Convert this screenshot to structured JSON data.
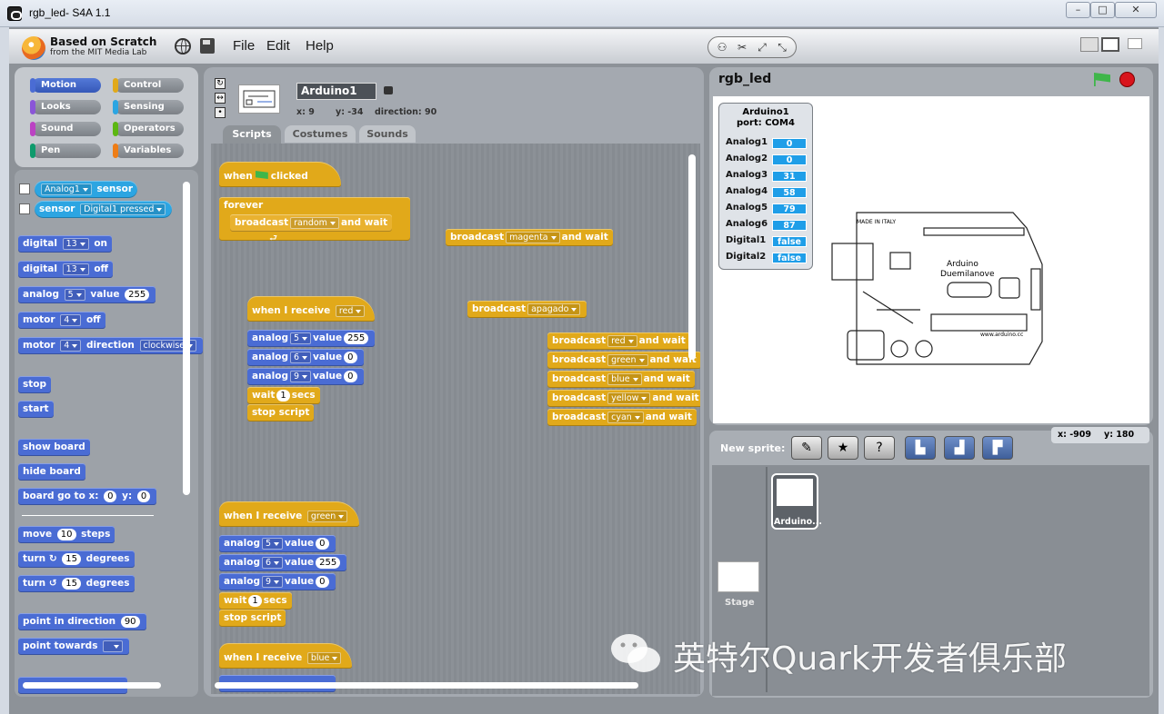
{
  "window": {
    "title": "rgb_led- S4A 1.1",
    "min": "–",
    "max": "□",
    "close": "✕"
  },
  "logo": {
    "line1": "Based on Scratch",
    "line2": "from the MIT Media Lab"
  },
  "menu": {
    "file": "File",
    "edit": "Edit",
    "help": "Help"
  },
  "categories": [
    {
      "label": "Motion",
      "color": "#4a6cd4"
    },
    {
      "label": "Control",
      "color": "#e1a91a"
    },
    {
      "label": "Looks",
      "color": "#8a55d7"
    },
    {
      "label": "Sensing",
      "color": "#2ca5e2"
    },
    {
      "label": "Sound",
      "color": "#bb42c3"
    },
    {
      "label": "Operators",
      "color": "#5cb712"
    },
    {
      "label": "Pen",
      "color": "#0e9a6c"
    },
    {
      "label": "Variables",
      "color": "#ee7d16"
    }
  ],
  "palette": {
    "s1": {
      "dd": "Analog1",
      "t": "sensor"
    },
    "s2": {
      "t": "sensor",
      "dd": "Digital1 pressed"
    },
    "d1": {
      "t": "digital",
      "n": "13",
      "t2": "on"
    },
    "d2": {
      "t": "digital",
      "n": "13",
      "t2": "off"
    },
    "a1": {
      "t": "analog",
      "n": "5",
      "t2": "value",
      "v": "255"
    },
    "m1": {
      "t": "motor",
      "n": "4",
      "t2": "off"
    },
    "m2": {
      "t": "motor",
      "n": "4",
      "t2": "direction",
      "dd": "clockwise"
    },
    "stop": "stop",
    "start": "start",
    "show": "show board",
    "hide": "hide board",
    "go": {
      "t": "board go to x:",
      "x": "0",
      "t2": "y:",
      "y": "0"
    },
    "move": {
      "t": "move",
      "n": "10",
      "t2": "steps"
    },
    "tr": {
      "t": "turn",
      "n": "15",
      "t2": "degrees"
    },
    "tl": {
      "t": "turn",
      "n": "15",
      "t2": "degrees"
    },
    "pd": {
      "t": "point in direction",
      "v": "90"
    },
    "pt": {
      "t": "point towards"
    }
  },
  "sprite": {
    "name": "Arduino1",
    "x": "x: 9",
    "y": "y: -34",
    "dir": "direction: 90"
  },
  "tabs": {
    "scripts": "Scripts",
    "costumes": "Costumes",
    "sounds": "Sounds"
  },
  "scripts": {
    "flag": {
      "when": "when",
      "clicked": "clicked",
      "forever": "forever",
      "bc": "broadcast",
      "msg": "random",
      "wait": "and wait"
    },
    "magenta": {
      "bc": "broadcast",
      "msg": "magenta",
      "wait": "and wait"
    },
    "apagado": {
      "bc": "broadcast",
      "msg": "apagado"
    },
    "red": {
      "hat": "when I receive",
      "msg": "red",
      "a": [
        [
          "5",
          "255"
        ],
        [
          "6",
          "0"
        ],
        [
          "9",
          "0"
        ]
      ],
      "wait": "wait",
      "secs": "1",
      "secs_t": "secs",
      "stop": "stop script"
    },
    "bcl": [
      {
        "bc": "broadcast",
        "msg": "red",
        "wait": "and wait"
      },
      {
        "bc": "broadcast",
        "msg": "green",
        "wait": "and wait"
      },
      {
        "bc": "broadcast",
        "msg": "blue",
        "wait": "and wait"
      },
      {
        "bc": "broadcast",
        "msg": "yellow",
        "wait": "and wait"
      },
      {
        "bc": "broadcast",
        "msg": "cyan",
        "wait": "and wait"
      }
    ],
    "green": {
      "hat": "when I receive",
      "msg": "green",
      "a": [
        [
          "5",
          "0"
        ],
        [
          "6",
          "255"
        ],
        [
          "9",
          "0"
        ]
      ],
      "wait": "wait",
      "secs": "1",
      "secs_t": "secs",
      "stop": "stop script"
    },
    "blue": {
      "hat": "when I receive",
      "msg": "blue"
    },
    "analog": "analog",
    "value": "value"
  },
  "stage": {
    "title": "rgb_led",
    "board_text1": "Arduino",
    "board_text2": "Duemilanove",
    "made": "MADE IN ITALY",
    "web": "www.arduino.cc"
  },
  "watch": {
    "title": "Arduino1",
    "port": "port: COM4",
    "rows": [
      {
        "l": "Analog1",
        "v": "0"
      },
      {
        "l": "Analog2",
        "v": "0"
      },
      {
        "l": "Analog3",
        "v": "31"
      },
      {
        "l": "Analog4",
        "v": "58"
      },
      {
        "l": "Analog5",
        "v": "79"
      },
      {
        "l": "Analog6",
        "v": "87"
      },
      {
        "l": "Digital1",
        "v": "false"
      },
      {
        "l": "Digital2",
        "v": "false"
      }
    ]
  },
  "newsprite": "New sprite:",
  "mouse": {
    "x": "x: -909",
    "y": "y: 180"
  },
  "sprites": [
    {
      "name": "Arduino..."
    }
  ],
  "stage_label": "Stage",
  "watermark": "英特尔Quark开发者俱乐部"
}
